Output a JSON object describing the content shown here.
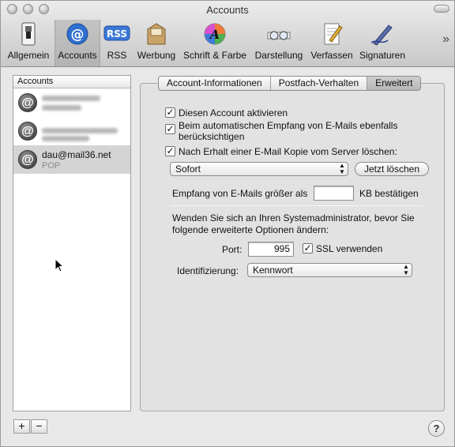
{
  "window": {
    "title": "Accounts"
  },
  "toolbar": {
    "items": [
      {
        "label": "Allgemein",
        "icon": "switch-icon"
      },
      {
        "label": "Accounts",
        "icon": "at-icon"
      },
      {
        "label": "RSS",
        "icon": "rss-icon"
      },
      {
        "label": "Werbung",
        "icon": "junk-mail-icon"
      },
      {
        "label": "Schrift & Farbe",
        "icon": "font-color-icon"
      },
      {
        "label": "Darstellung",
        "icon": "glasses-icon"
      },
      {
        "label": "Verfassen",
        "icon": "compose-icon"
      },
      {
        "label": "Signaturen",
        "icon": "pen-icon"
      }
    ],
    "rss_badge": "RSS",
    "font_letter": "A",
    "overflow": "»"
  },
  "accounts": {
    "header": "Accounts",
    "rows": [
      {
        "name": "",
        "type": ""
      },
      {
        "name": "",
        "type": ""
      },
      {
        "name": "dau@mail36.net",
        "type": "POP"
      }
    ],
    "at_symbol": "@",
    "add_label": "+",
    "remove_label": "−"
  },
  "tabs": [
    "Account-Informationen",
    "Postfach-Verhalten",
    "Erweitert"
  ],
  "advanced": {
    "enable_account": "Diesen Account aktivieren",
    "include_auto_line1": "Beim automatischen Empfang von E-Mails ebenfalls",
    "include_auto_line2": "berücksichtigen",
    "delete_after": "Nach Erhalt einer E-Mail Kopie vom Server löschen:",
    "delete_when": "Sofort",
    "delete_now": "Jetzt löschen",
    "prompt_prefix": "Empfang von E-Mails größer als",
    "prompt_value": "",
    "prompt_suffix": "KB bestätigen",
    "admin_note_line1": "Wenden Sie sich an Ihren Systemadministrator, bevor Sie",
    "admin_note_line2": "folgende erweiterte Optionen ändern:",
    "port_label": "Port:",
    "port_value": "995",
    "ssl_label": "SSL verwenden",
    "auth_label": "Identifizierung:",
    "auth_value": "Kennwort",
    "check_mark": "✓"
  },
  "help_label": "?"
}
